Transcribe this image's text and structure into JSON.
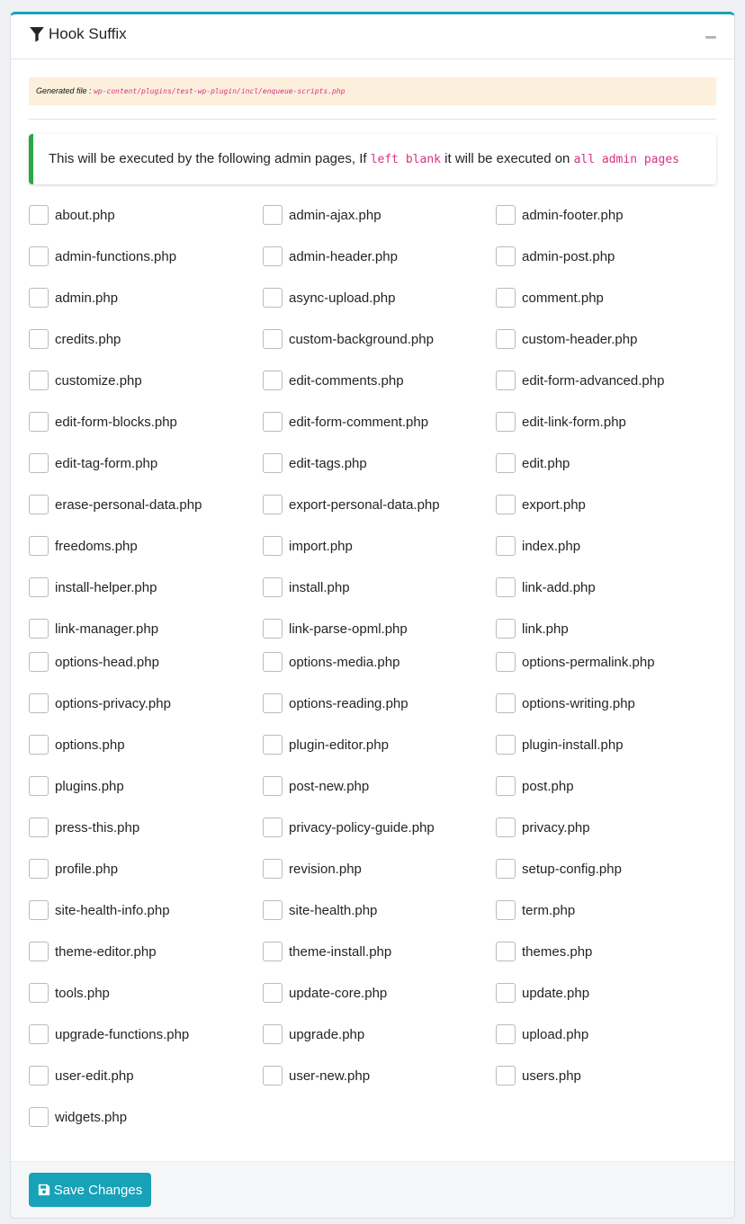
{
  "header": {
    "title": "Hook Suffix"
  },
  "generated": {
    "label": "Generated file :",
    "path": "wp-content/plugins/test-wp-plugin/incl/enqueue-scripts.php"
  },
  "callout": {
    "part1": "This will be executed by the following admin pages, If ",
    "code1": "left blank",
    "part2": " it will be executed on ",
    "code2": "all admin pages"
  },
  "options": [
    "about.php",
    "admin-ajax.php",
    "admin-footer.php",
    "admin-functions.php",
    "admin-header.php",
    "admin-post.php",
    "admin.php",
    "async-upload.php",
    "comment.php",
    "credits.php",
    "custom-background.php",
    "custom-header.php",
    "customize.php",
    "edit-comments.php",
    "edit-form-advanced.php",
    "edit-form-blocks.php",
    "edit-form-comment.php",
    "edit-link-form.php",
    "edit-tag-form.php",
    "edit-tags.php",
    "edit.php",
    "erase-personal-data.php",
    "export-personal-data.php",
    "export.php",
    "freedoms.php",
    "import.php",
    "index.php",
    "install-helper.php",
    "install.php",
    "link-add.php",
    "link-manager.php",
    "link-parse-opml.php",
    "link.php",
    "options-head.php",
    "options-media.php",
    "options-permalink.php",
    "options-privacy.php",
    "options-reading.php",
    "options-writing.php",
    "options.php",
    "plugin-editor.php",
    "plugin-install.php",
    "plugins.php",
    "post-new.php",
    "post.php",
    "press-this.php",
    "privacy-policy-guide.php",
    "privacy.php",
    "profile.php",
    "revision.php",
    "setup-config.php",
    "site-health-info.php",
    "site-health.php",
    "term.php",
    "theme-editor.php",
    "theme-install.php",
    "themes.php",
    "tools.php",
    "update-core.php",
    "update.php",
    "upgrade-functions.php",
    "upgrade.php",
    "upload.php",
    "user-edit.php",
    "user-new.php",
    "users.php",
    "widgets.php"
  ],
  "footer": {
    "save_label": "Save Changes"
  },
  "colors": {
    "accent": "#17a2b8",
    "callout_border": "#28a745",
    "code": "#d63384",
    "generated_bg": "#fcefdc"
  }
}
